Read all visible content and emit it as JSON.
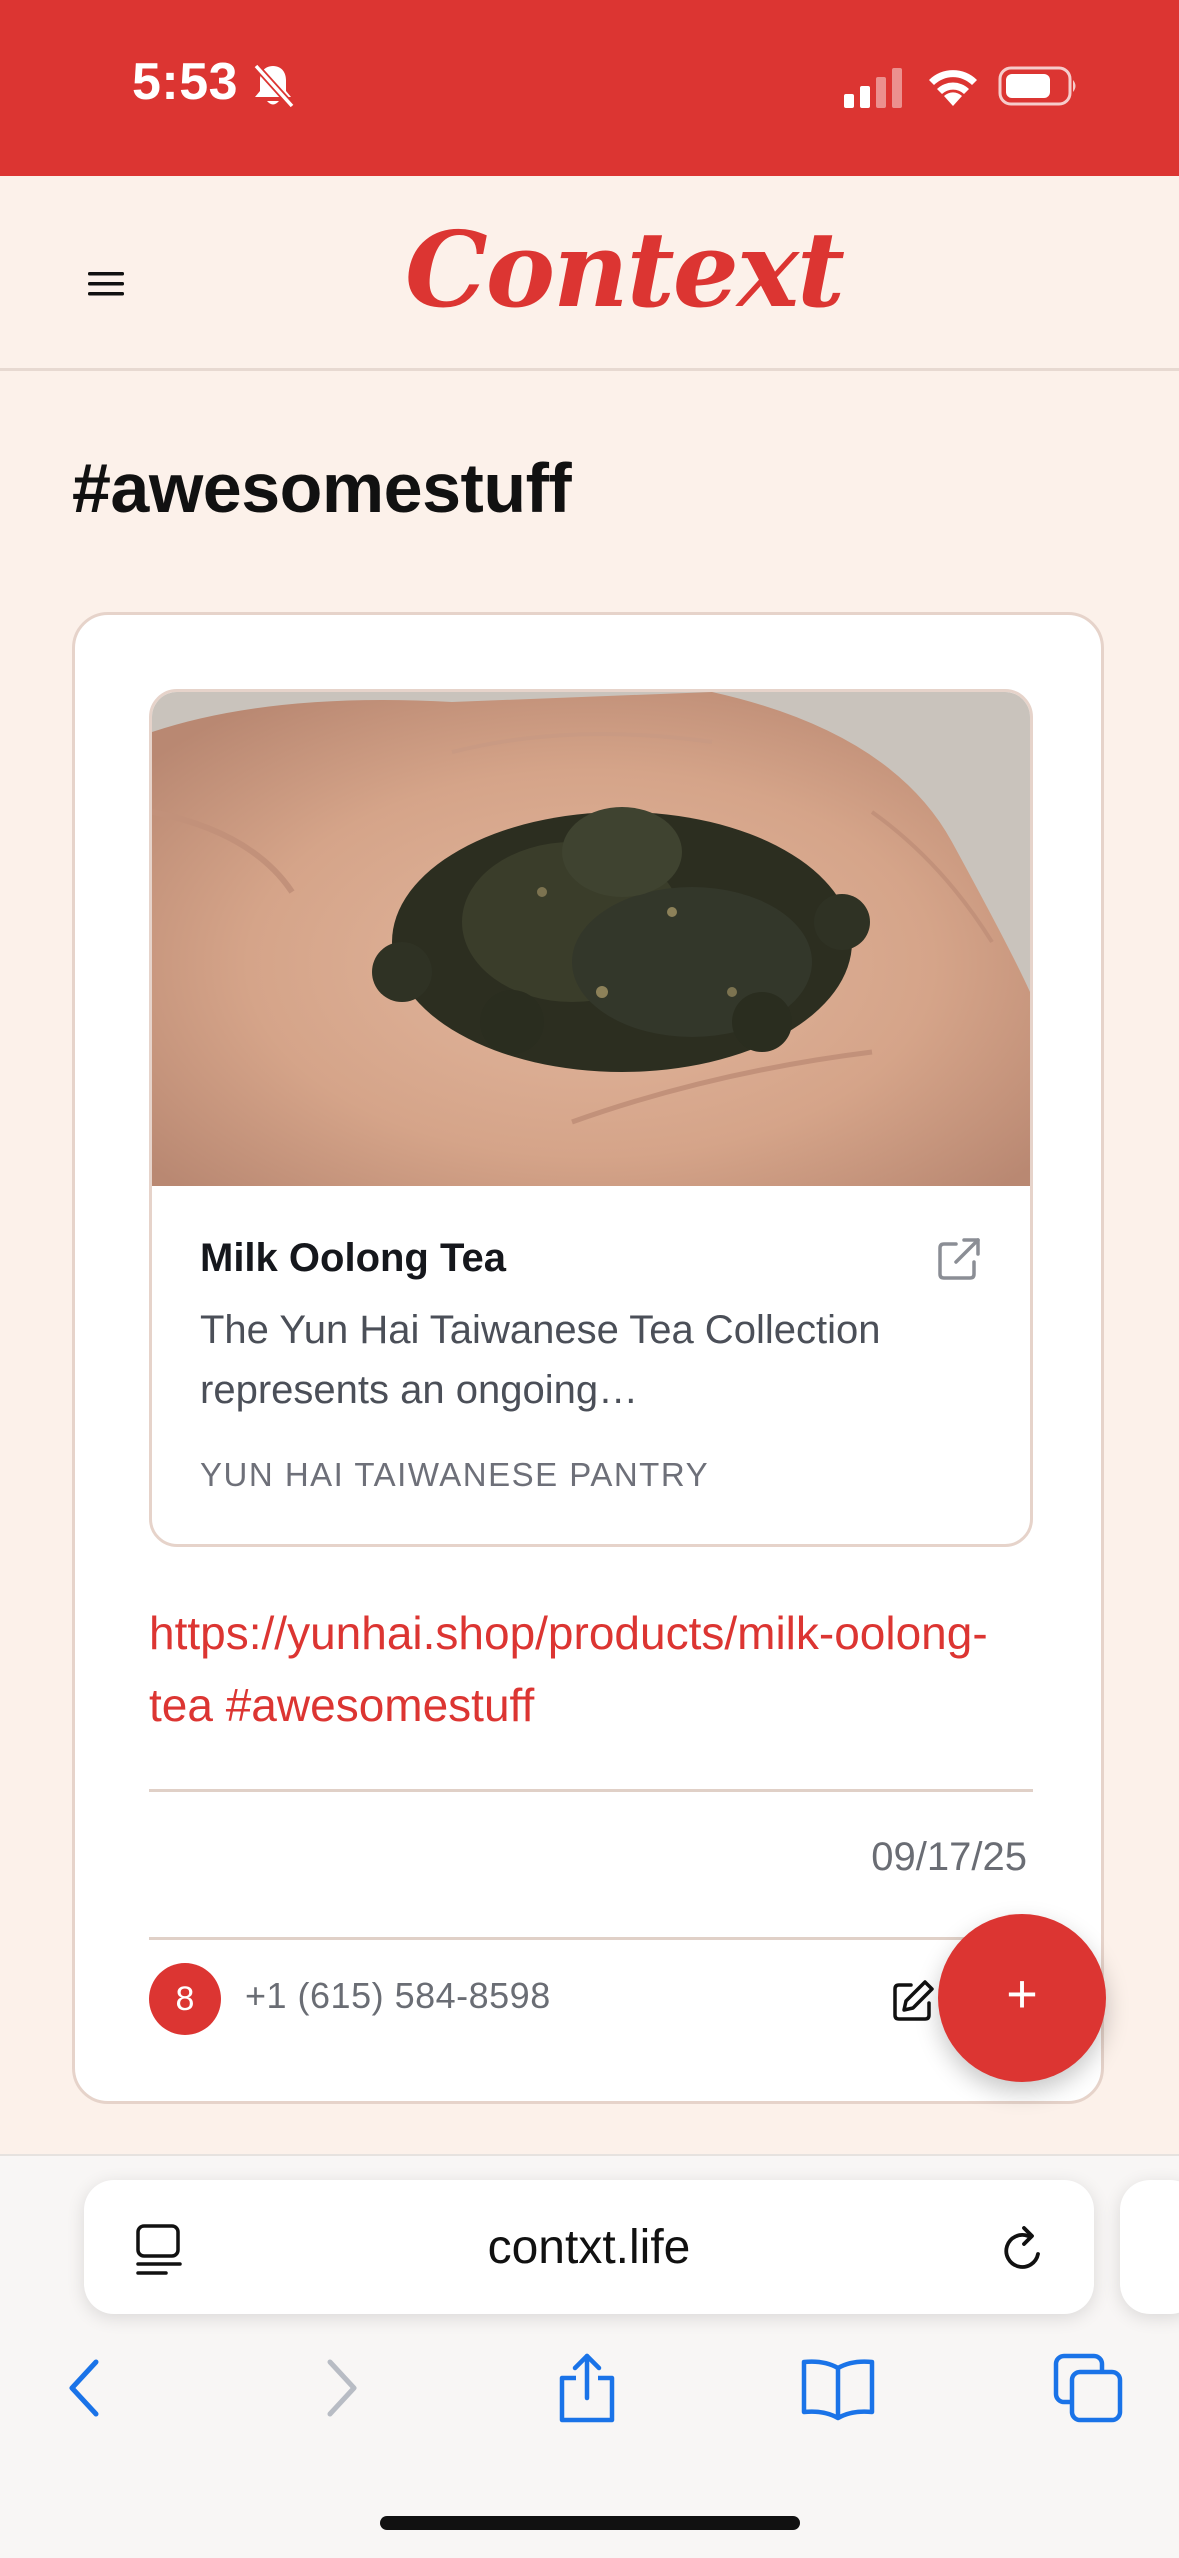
{
  "status_bar": {
    "time": "5:53",
    "background_color": "#dc3532",
    "icons": [
      "bell-slash-icon",
      "signal-icon",
      "wifi-icon",
      "battery-icon"
    ]
  },
  "header": {
    "brand": "Context",
    "brand_color": "#dc3532",
    "menu_icon": "hamburger-menu-icon"
  },
  "page": {
    "title": "#awesomestuff"
  },
  "post": {
    "preview": {
      "title": "Milk Oolong Tea",
      "description": "The Yun Hai Taiwanese Tea Collection represents an ongoing…",
      "source": "YUN HAI TAIWANESE PANTRY",
      "image_subject": "loose oolong tea leaves in an open palm"
    },
    "link_text": "https://yunhai.shop/products/milk-oolong-tea #awesomestuff",
    "date": "09/17/25",
    "author": {
      "avatar_label": "8",
      "phone": "+1 (615) 584-8598"
    }
  },
  "fab": {
    "label": "+"
  },
  "browser": {
    "address": "contxt.life",
    "toolbar_icons": [
      "back-icon",
      "forward-icon",
      "share-icon",
      "bookmarks-icon",
      "tabs-icon"
    ],
    "accent_color": "#1a73e8"
  },
  "colors": {
    "accent": "#dc3532",
    "page_background": "#fcf1ea",
    "card_border": "#e6d3ca"
  }
}
